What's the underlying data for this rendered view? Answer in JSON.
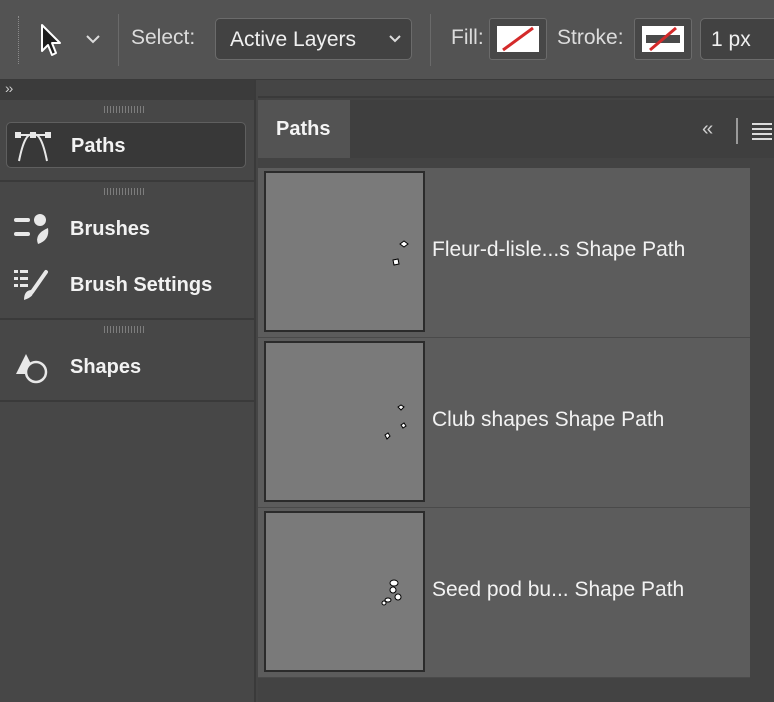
{
  "options_bar": {
    "select_label": "Select:",
    "select_value": "Active Layers",
    "fill_label": "Fill:",
    "stroke_label": "Stroke:",
    "stroke_width": "1 px",
    "tool_icon": "direct-selection-arrow-icon"
  },
  "dock": {
    "expand_glyph": "››",
    "items": [
      {
        "label": "Paths",
        "icon": "paths-icon",
        "active": true
      },
      {
        "label": "Brushes",
        "icon": "brushes-icon",
        "active": false
      },
      {
        "label": "Brush Settings",
        "icon": "brush-settings-icon",
        "active": false
      },
      {
        "label": "Shapes",
        "icon": "shapes-icon",
        "active": false
      }
    ]
  },
  "paths_panel": {
    "tab_label": "Paths",
    "collapse_glyph": "‹‹",
    "paths": [
      {
        "name": "Fleur-d-lisle...s Shape Path"
      },
      {
        "name": "Club shapes Shape Path"
      },
      {
        "name": "Seed pod bu... Shape Path"
      }
    ]
  },
  "colors": {
    "no_color_slash": "#d42a2a",
    "panel_bg": "#434343",
    "row_bg": "#5c5c5c"
  }
}
